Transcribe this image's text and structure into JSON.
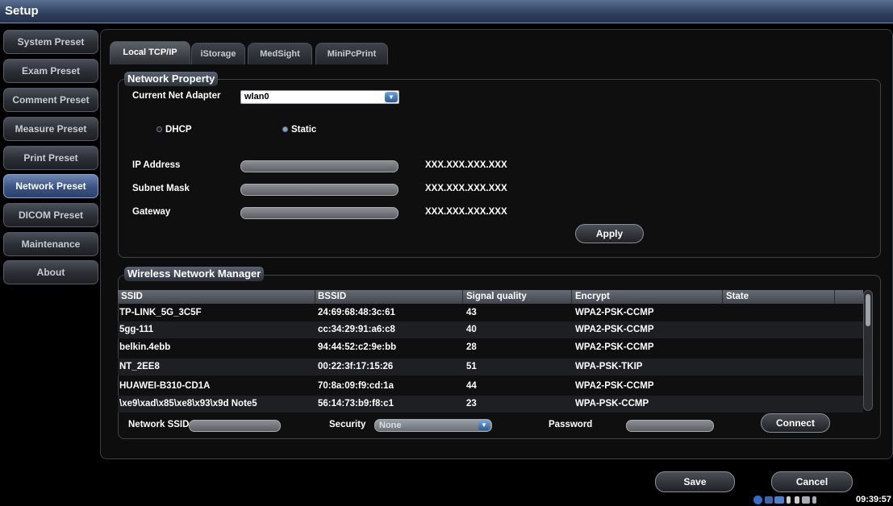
{
  "window": {
    "title": "Setup"
  },
  "sidebar": {
    "items": [
      {
        "label": "System Preset"
      },
      {
        "label": "Exam Preset"
      },
      {
        "label": "Comment Preset"
      },
      {
        "label": "Measure Preset"
      },
      {
        "label": "Print Preset"
      },
      {
        "label": "Network Preset",
        "active": true
      },
      {
        "label": "DICOM Preset"
      },
      {
        "label": "Maintenance"
      },
      {
        "label": "About"
      }
    ]
  },
  "tabs": [
    {
      "label": "Local TCP/IP",
      "active": true
    },
    {
      "label": "iStorage"
    },
    {
      "label": "MedSight"
    },
    {
      "label": "MiniPcPrint"
    }
  ],
  "network_property": {
    "title": "Network Property",
    "adapter_label": "Current Net Adapter",
    "adapter_value": "wlan0",
    "dhcp_label": "DHCP",
    "static_label": "Static",
    "selected_mode": "Static",
    "ip_label": "IP Address",
    "ip_value": "XXX.XXX.XXX.XXX",
    "subnet_label": "Subnet Mask",
    "subnet_value": "XXX.XXX.XXX.XXX",
    "gateway_label": "Gateway",
    "gateway_value": "XXX.XXX.XXX.XXX",
    "apply_label": "Apply"
  },
  "wireless": {
    "title": "Wireless Network Manager",
    "columns": [
      "SSID",
      "BSSID",
      "Signal quality",
      "Encrypt",
      "State"
    ],
    "rows": [
      {
        "ssid": "TP-LINK_5G_3C5F",
        "bssid": "24:69:68:48:3c:61",
        "signal": "43",
        "encrypt": "WPA2-PSK-CCMP",
        "state": ""
      },
      {
        "ssid": "5gg-111",
        "bssid": "cc:34:29:91:a6:c8",
        "signal": "40",
        "encrypt": "WPA2-PSK-CCMP",
        "state": ""
      },
      {
        "ssid": "belkin.4ebb",
        "bssid": "94:44:52:c2:9e:bb",
        "signal": "28",
        "encrypt": "WPA2-PSK-CCMP",
        "state": ""
      },
      {
        "ssid": "NT_2EE8",
        "bssid": "00:22:3f:17:15:26",
        "signal": "51",
        "encrypt": "WPA-PSK-TKIP",
        "state": ""
      },
      {
        "ssid": "HUAWEI-B310-CD1A",
        "bssid": "70:8a:09:f9:cd:1a",
        "signal": "44",
        "encrypt": "WPA2-PSK-CCMP",
        "state": ""
      },
      {
        "ssid": "\\xe9\\xad\\x85\\xe8\\x93\\x9d Note5",
        "bssid": "56:14:73:b9:f8:c1",
        "signal": "23",
        "encrypt": "WPA-PSK-CCMP",
        "state": ""
      }
    ],
    "ssid_label": "Network SSID",
    "security_label": "Security",
    "security_value": "None",
    "password_label": "Password",
    "connect_label": "Connect"
  },
  "footer": {
    "save_label": "Save",
    "cancel_label": "Cancel",
    "clock": "09:39:57"
  }
}
